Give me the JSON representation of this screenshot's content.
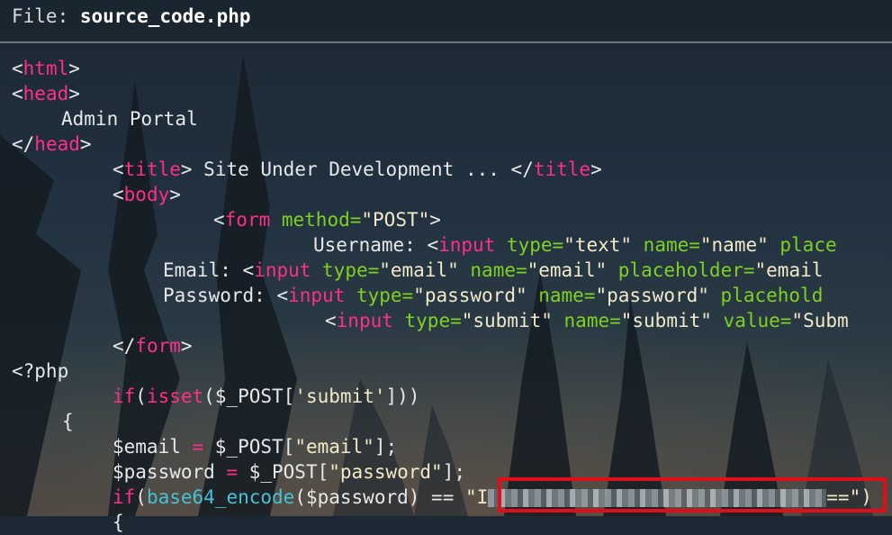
{
  "header": {
    "label": "File: ",
    "filename": "source_code.php"
  },
  "code": {
    "l1": {
      "open": "<",
      "tag": "html",
      "close": ">"
    },
    "l2": {
      "open": "<",
      "tag": "head",
      "close": ">"
    },
    "l3": {
      "text": "Admin Portal"
    },
    "l4": {
      "open": "</",
      "tag": "head",
      "close": ">"
    },
    "l5": {
      "open": "<",
      "tag": "title",
      "close": ">",
      "text": " Site Under Development ... ",
      "open2": "</",
      "tag2": "title",
      "close2": ">"
    },
    "l6": {
      "open": "<",
      "tag": "body",
      "close": ">"
    },
    "l7": {
      "open": "<",
      "tag": "form",
      "attr": " method=",
      "val": "\"POST\"",
      "close": ">"
    },
    "l8": {
      "text": "Username: ",
      "open": "<",
      "tag": "input",
      "a1": " type=",
      "v1": "\"text\"",
      "a2": " name=",
      "v2": "\"name\"",
      "a3": " place"
    },
    "l9": {
      "text": "Email: ",
      "open": "<",
      "tag": "input",
      "a1": " type=",
      "v1": "\"email\"",
      "a2": " name=",
      "v2": "\"email\"",
      "a3": " placeholder=",
      "v3": "\"email"
    },
    "l10": {
      "text": "Password: ",
      "open": "<",
      "tag": "input",
      "a1": " type=",
      "v1": "\"password\"",
      "a2": " name=",
      "v2": "\"password\"",
      "a3": " placehold"
    },
    "l11": {
      "open": "<",
      "tag": "input",
      "a1": " type=",
      "v1": "\"submit\"",
      "a2": " name=",
      "v2": "\"submit\"",
      "a3": " value=",
      "v3": "\"Subm"
    },
    "l12": {
      "open": "</",
      "tag": "form",
      "close": ">"
    },
    "l13": {
      "text": "<?php"
    },
    "l14": {
      "kw": "if",
      "p1": "(",
      "fn": "isset",
      "p2": "(",
      "var": "$_POST[",
      "str": "'submit'",
      "p3": "]))"
    },
    "l15": {
      "text": "{"
    },
    "l16": {
      "var": "$email",
      "op": " = ",
      "post": "$_POST[",
      "str": "\"email\"",
      "end": "];"
    },
    "l17": {
      "var": "$password",
      "op": " = ",
      "post": "$_POST[",
      "str": "\"password\"",
      "end": "];"
    },
    "l18": {
      "kw": "if",
      "p1": "(",
      "fn": "base64_encode",
      "p2": "($password) == ",
      "q": "\"I",
      "tail": "==\")"
    },
    "l19": {
      "text": "{"
    }
  },
  "colors": {
    "tag": "#ff2e88",
    "attr": "#7fd121",
    "func": "#42c3d6",
    "highlight": "#e10d18"
  }
}
